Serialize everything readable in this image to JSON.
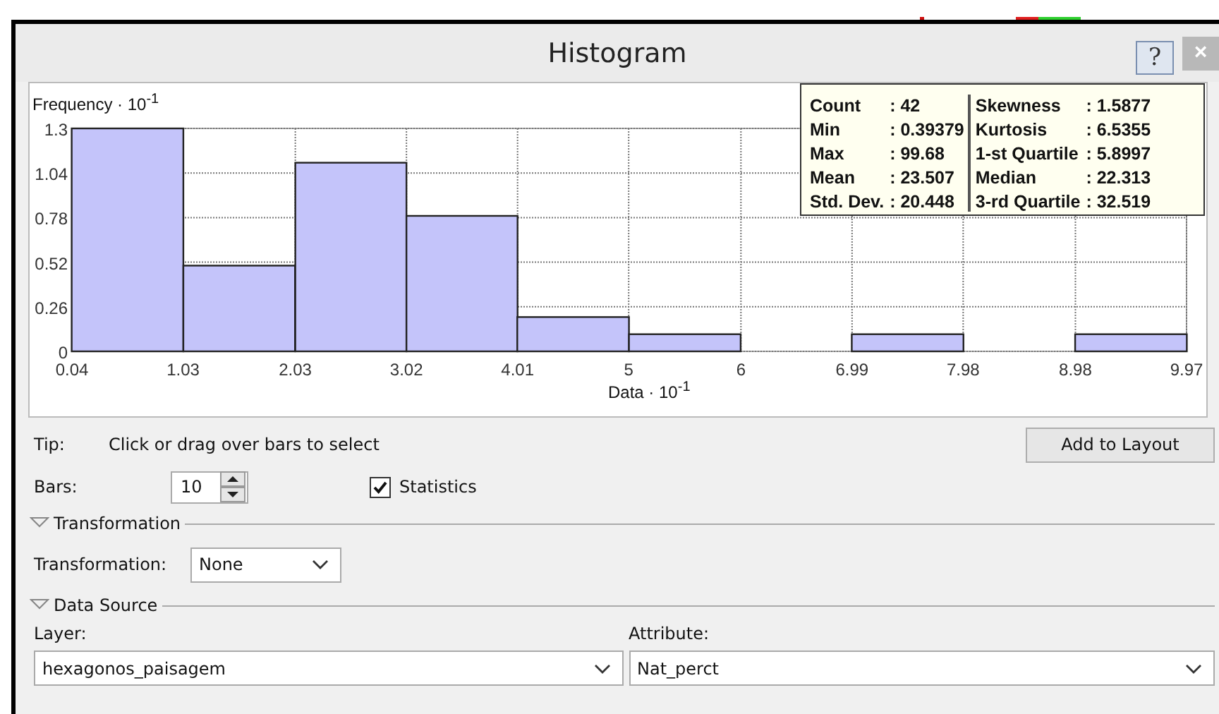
{
  "window": {
    "title": "Histogram",
    "help_button": "?",
    "close_button": "×"
  },
  "chart": {
    "chart_data": {
      "type": "bar",
      "xlabel": "Data · 10$^{-1}$",
      "ylabel": "Frequency · 10$^{-1}$",
      "x": [
        0.535,
        1.53,
        2.525,
        3.515,
        4.505,
        5.5,
        6.495,
        7.485,
        8.48,
        9.475
      ],
      "grid": true,
      "values": [
        1.3,
        0.5,
        1.1,
        0.79,
        0.2,
        0.1,
        0,
        0.1,
        0,
        0.1
      ],
      "xlim": [
        0.04,
        9.97
      ],
      "ylim": [
        0,
        1.3
      ],
      "xticks": [
        0.04,
        1.03,
        2.03,
        3.02,
        4.01,
        5,
        6,
        6.99,
        7.98,
        8.98,
        9.97
      ],
      "yticks": [
        0,
        0.26,
        0.52,
        0.78,
        1.04,
        1.3
      ]
    },
    "statistics": [
      [
        {
          "label": "Count",
          "value": ": 42"
        },
        {
          "label": "Min",
          "value": ": 0.39379"
        },
        {
          "label": "Max",
          "value": ": 99.68"
        },
        {
          "label": "Mean",
          "value": ": 23.507"
        },
        {
          "label": "Std. Dev.",
          "value": ": 20.448"
        }
      ],
      [
        {
          "label": "Skewness",
          "value": ": 1.5877"
        },
        {
          "label": "Kurtosis",
          "value": ": 6.5355"
        },
        {
          "label": "1-st Quartile",
          "value": ": 5.8997"
        },
        {
          "label": "Median",
          "value": ": 22.313"
        },
        {
          "label": "3-rd Quartile",
          "value": ": 32.519"
        }
      ]
    ]
  },
  "tip": {
    "label": "Tip:",
    "text": "Click or drag over bars to select"
  },
  "add_to_layout_button": "Add to Layout",
  "bars": {
    "label": "Bars:",
    "value": "10"
  },
  "statistics_checkbox": {
    "label": "Statistics",
    "checked": true
  },
  "transformation_group": {
    "title": "Transformation",
    "expanded": true,
    "label": "Transformation:",
    "value": "None"
  },
  "data_source_group": {
    "title": "Data Source",
    "expanded": true,
    "layer_label": "Layer:",
    "layer": "hexagonos_paisagem",
    "attribute_label": "Attribute:",
    "attribute": "Nat_perct"
  }
}
